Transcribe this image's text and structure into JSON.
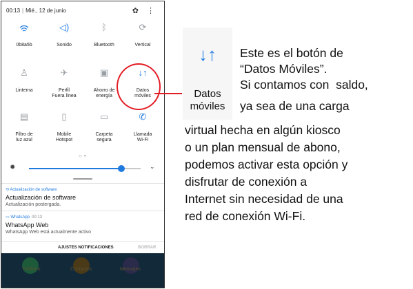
{
  "status_bar": {
    "time": "00:13",
    "date": "Mié., 12 de junio",
    "icons": [
      "gear-icon",
      "more-vert-icon"
    ]
  },
  "quick_settings": [
    {
      "name": "wifi",
      "label": "0b8a5b",
      "icon": "wifi-icon",
      "active": true
    },
    {
      "name": "sound",
      "label": "Sonido",
      "icon": "speaker-icon",
      "active": true
    },
    {
      "name": "bluetooth",
      "label": "Bluetooth",
      "icon": "bluetooth-icon",
      "active": false
    },
    {
      "name": "rotation",
      "label": "Vertical",
      "icon": "rotate-icon",
      "active": false
    },
    {
      "name": "flashlight",
      "label": "Linterna",
      "icon": "flashlight-icon",
      "active": false
    },
    {
      "name": "airplane",
      "label": "Perfil\nFuera línea",
      "icon": "airplane-icon",
      "active": false
    },
    {
      "name": "power-saving",
      "label": "Ahorro de\nenergía",
      "icon": "battery-icon",
      "active": false
    },
    {
      "name": "mobile-data",
      "label": "Datos\nmóviles",
      "icon": "data-arrows-icon",
      "active": true
    },
    {
      "name": "blue-light",
      "label": "Filtro de\nluz azul",
      "icon": "filter-icon",
      "active": false
    },
    {
      "name": "hotspot",
      "label": "Mobile\nHotspot",
      "icon": "hotspot-icon",
      "active": false
    },
    {
      "name": "secure-folder",
      "label": "Carpeta\nsegura",
      "icon": "folder-icon",
      "active": false
    },
    {
      "name": "wifi-call",
      "label": "Llamada\nWi-Fi",
      "icon": "wifi-call-icon",
      "active": true
    }
  ],
  "brightness": {
    "level": 0.84
  },
  "notifications": [
    {
      "app": "Actualización de software",
      "time": "",
      "title": "Actualización de software",
      "text": "Actualización postergada."
    },
    {
      "app": "WhatsApp",
      "time": "00:13",
      "title": "WhatsApp Web",
      "text": "WhatsApp Web está actualmente activo"
    }
  ],
  "notif_actions": {
    "settings": "AJUSTES NOTIFICACIONES",
    "clear": "BORRAR"
  },
  "dock": [
    "Teléfono",
    "Contactos",
    "Mensajes"
  ],
  "callout": {
    "icon": "data-arrows-icon",
    "label_line1": "Datos",
    "label_line2": "móviles",
    "text": [
      "Este es el botón de",
      "“Datos Móviles”.",
      "Si contamos con  saldo,",
      "ya sea de una carga",
      "virtual hecha en algún kiosco",
      "o un plan mensual de abono,",
      "podemos activar esta opción y",
      "disfrutar de conexión a",
      "Internet sin necesidad de una",
      "red de conexión Wi-Fi."
    ]
  },
  "colors": {
    "accent": "#1f7ae0",
    "highlight": "#e31c24",
    "dock": "#12293a"
  }
}
